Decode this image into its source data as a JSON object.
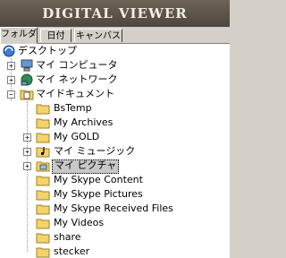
{
  "header": {
    "title": "DIGITAL VIEWER"
  },
  "tabs": [
    {
      "label": "フォルダ",
      "active": true
    },
    {
      "label": "日付",
      "active": false
    },
    {
      "label": "キャンバス",
      "active": false
    }
  ],
  "tree": {
    "root": {
      "label": "デスクトップ",
      "icon": "desktop-icon"
    },
    "items": [
      {
        "label": "マイ コンピュータ",
        "icon": "computer-icon",
        "expander": "+"
      },
      {
        "label": "マイ ネットワーク",
        "icon": "network-icon",
        "expander": "+"
      },
      {
        "label": "マイドキュメント",
        "icon": "documents-folder-icon",
        "expander": "−"
      }
    ],
    "children": [
      {
        "label": "BsTemp",
        "icon": "folder-icon",
        "expander": ""
      },
      {
        "label": "My Archives",
        "icon": "folder-icon",
        "expander": ""
      },
      {
        "label": "My GOLD",
        "icon": "folder-icon",
        "expander": "+"
      },
      {
        "label": "マイ ミュージック",
        "icon": "music-folder-icon",
        "expander": "+"
      },
      {
        "label": "マイ ピクチャ",
        "icon": "pictures-folder-icon",
        "expander": "+",
        "selected": true
      },
      {
        "label": "My Skype Content",
        "icon": "folder-icon",
        "expander": ""
      },
      {
        "label": "My Skype Pictures",
        "icon": "folder-icon",
        "expander": ""
      },
      {
        "label": "My Skype Received Files",
        "icon": "folder-icon",
        "expander": ""
      },
      {
        "label": "My Videos",
        "icon": "folder-icon",
        "expander": ""
      },
      {
        "label": "share",
        "icon": "folder-icon",
        "expander": ""
      },
      {
        "label": "stecker",
        "icon": "folder-icon",
        "expander": ""
      }
    ]
  }
}
